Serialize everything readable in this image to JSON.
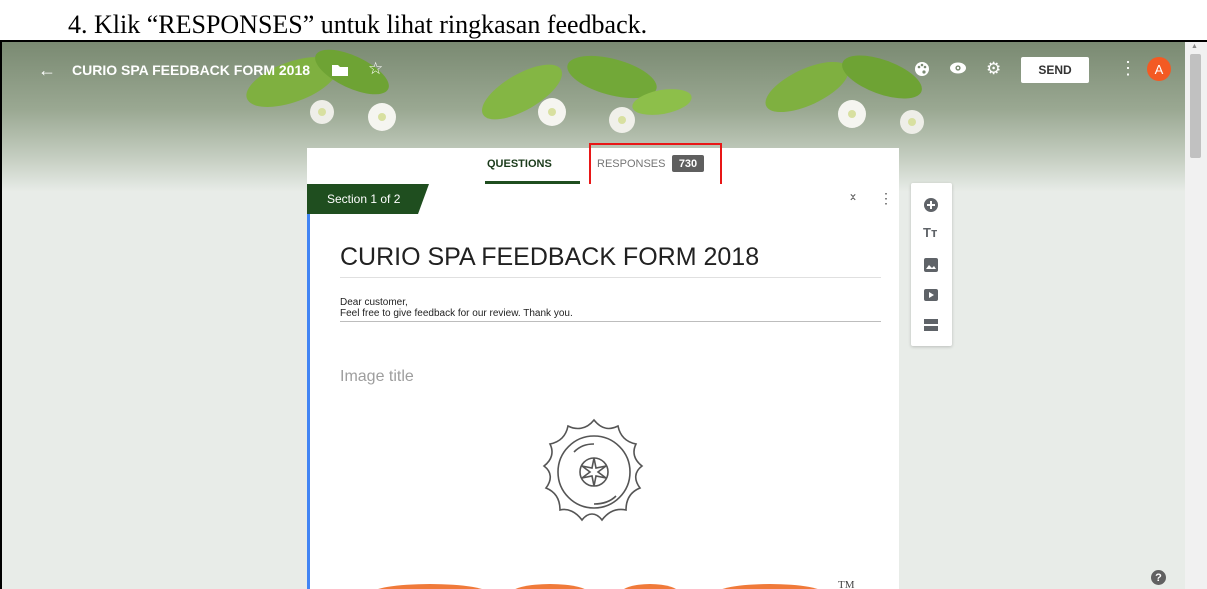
{
  "instruction": {
    "text": "4.  Klik “RESPONSES” untuk lihat ringkasan feedback."
  },
  "header": {
    "form_title": "CURIO SPA FEEDBACK FORM 2018",
    "send_label": "SEND",
    "avatar_letter": "A"
  },
  "tabs": {
    "questions_label": "QUESTIONS",
    "responses_label": "RESPONSES",
    "responses_count": "730"
  },
  "form": {
    "section_label": "Section 1 of 2",
    "title": "CURIO SPA FEEDBACK FORM 2018",
    "description_line1": "Dear customer,",
    "description_line2": "Feel free to give feedback for our review. Thank you.",
    "image_title_placeholder": "Image title",
    "trademark": "TM"
  },
  "colors": {
    "accent_green": "#1f4e1f",
    "highlight_red": "#e81717",
    "avatar_orange": "#f35a23",
    "logo_orange": "#f07a3a",
    "left_accent_blue": "#4285f4"
  },
  "icons": {
    "back": "arrow-left-icon",
    "folder": "folder-icon",
    "star": "star-icon",
    "palette": "palette-icon",
    "preview": "eye-icon",
    "settings": "gear-icon",
    "more": "more-vert-icon",
    "help": "help-icon",
    "rail": [
      "add-question-icon",
      "add-title-icon",
      "add-image-icon",
      "add-video-icon",
      "add-section-icon"
    ]
  }
}
